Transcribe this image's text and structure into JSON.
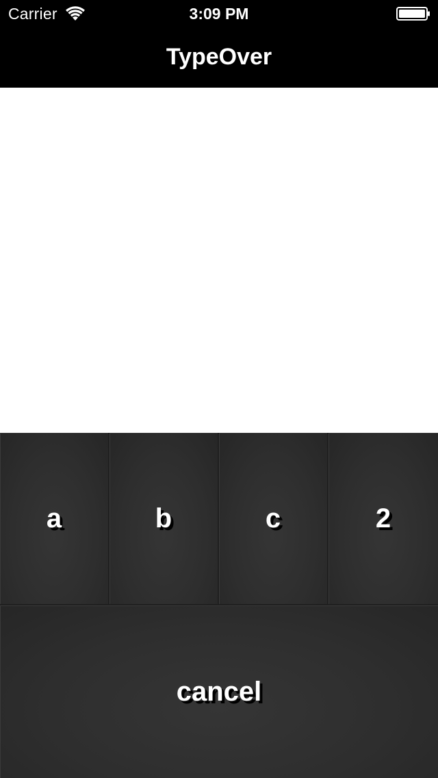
{
  "status_bar": {
    "carrier": "Carrier",
    "time": "3:09 PM",
    "wifi_icon": "wifi-icon",
    "battery_icon": "battery-icon"
  },
  "nav_bar": {
    "title": "TypeOver"
  },
  "keys": {
    "items": [
      {
        "label": "a"
      },
      {
        "label": "b"
      },
      {
        "label": "c"
      },
      {
        "label": "2"
      }
    ],
    "cancel_label": "cancel"
  },
  "colors": {
    "bar_background": "#000000",
    "panel_background": "#2b2b2b",
    "content_background": "#ffffff",
    "key_text": "#ffffff"
  }
}
